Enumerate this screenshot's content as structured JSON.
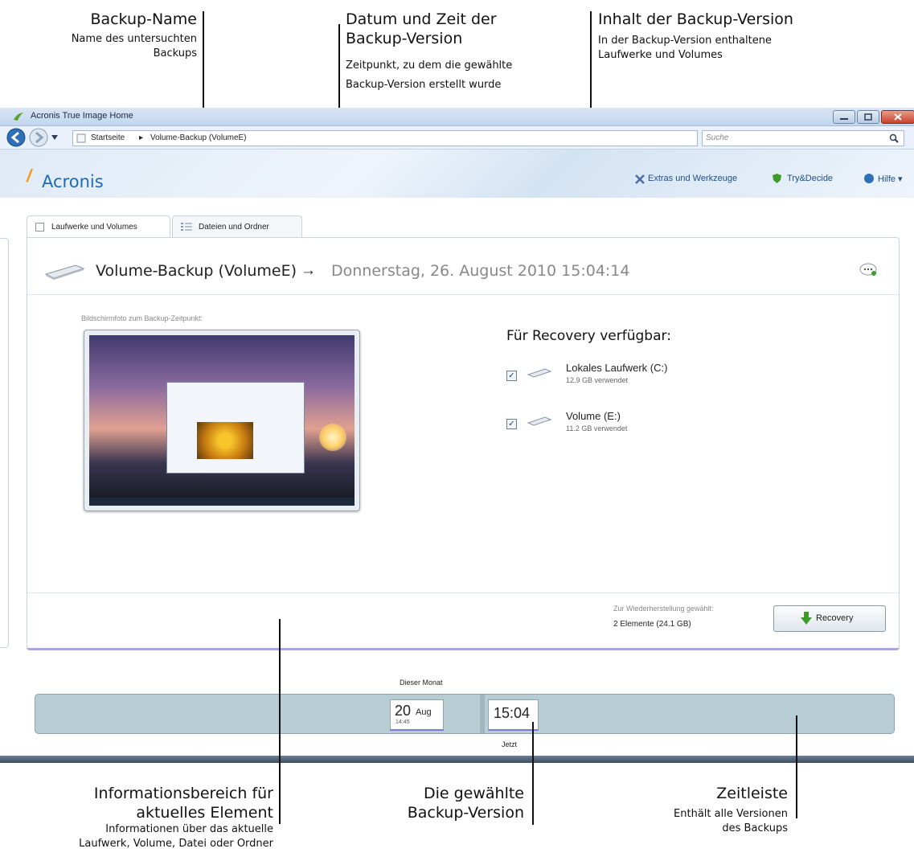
{
  "callouts": {
    "backup_name": {
      "title": "Backup-Name",
      "sub": [
        "Name des untersuchten",
        "Backups"
      ]
    },
    "date_time": {
      "title": [
        "Datum und Zeit der",
        "Backup-Version"
      ],
      "sub": [
        "Zeitpunkt, zu dem die gewählte",
        "Backup-Version erstellt wurde"
      ]
    },
    "content": {
      "title": "Inhalt der Backup-Version",
      "sub": [
        "In der Backup-Version enthaltene",
        "Laufwerke und Volumes"
      ]
    },
    "info_area": {
      "title": [
        "Informationsbereich für",
        "aktuelles Element"
      ],
      "sub": [
        "Informationen über das aktuelle",
        "Laufwerk, Volume, Datei oder Ordner"
      ]
    },
    "selected_version": {
      "title": [
        "Die gewählte",
        "Backup-Version"
      ]
    },
    "timeline": {
      "title": "Zeitleiste",
      "sub": [
        "Enthält alle Versionen",
        "des Backups"
      ]
    }
  },
  "window": {
    "title": "Acronis True Image Home",
    "breadcrumb": [
      "Startseite",
      "Volume-Backup (VolumeE)"
    ],
    "breadcrumb_sep": "▸",
    "search_placeholder": "Suche"
  },
  "header": {
    "logo": "Acronis",
    "links": [
      "Extras und Werkzeuge",
      "Try&Decide",
      "Hilfe ▾"
    ]
  },
  "tabs": [
    "Laufwerke und Volumes",
    "Dateien und Ordner"
  ],
  "panel": {
    "backup_name": "Volume-Backup (VolumeE)",
    "arrow": "→",
    "date": "Donnerstag, 26. August 2010 15:04:14",
    "screenshot_label": "Bildschirmfoto zum Backup-Zeitpunkt:",
    "recovery_title": "Für Recovery verfügbar:",
    "drives": [
      {
        "name": "Lokales Laufwerk (C:)",
        "usage": "12.9 GB verwendet",
        "checked": true
      },
      {
        "name": "Volume (E:)",
        "usage": "11.2 GB verwendet",
        "checked": true
      }
    ],
    "selection_label": "Zur Wiederherstellung gewählt:",
    "selection_value": "2 Elemente (24.1 GB)",
    "recovery_button": "Recovery"
  },
  "timeline": {
    "month_label": "Dieser Monat",
    "entry_day": "20",
    "entry_month": "Aug",
    "entry_time": "14:45",
    "selected_time": "15:04",
    "now_label": "Jetzt"
  },
  "colors": {
    "accent": "#1d6bb5",
    "timeline_bg": "#b8cdd3",
    "selection_bar": "#7e78d8"
  }
}
